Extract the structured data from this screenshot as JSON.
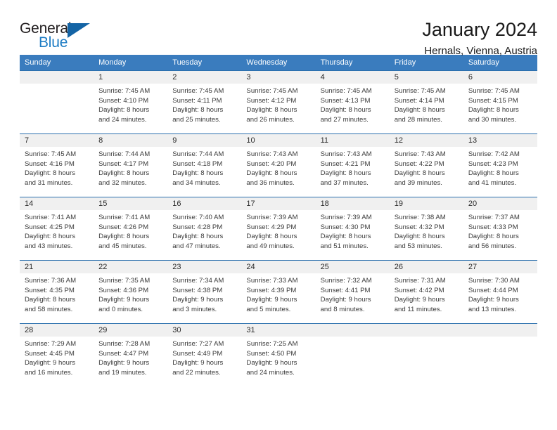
{
  "brand": {
    "name_top": "General",
    "name_bottom": "Blue",
    "accent_color": "#1d7cc4",
    "triangle_color": "#1464a5"
  },
  "header": {
    "title": "January 2024",
    "subtitle": "Hernals, Vienna, Austria"
  },
  "calendar": {
    "header_bg": "#3a7cbe",
    "daynum_bg": "#f0f0f0",
    "row_rule_color": "#2a6fad",
    "weekday_headers": [
      "Sunday",
      "Monday",
      "Tuesday",
      "Wednesday",
      "Thursday",
      "Friday",
      "Saturday"
    ],
    "weeks": [
      [
        {
          "day": "",
          "lines": []
        },
        {
          "day": "1",
          "lines": [
            "Sunrise: 7:45 AM",
            "Sunset: 4:10 PM",
            "Daylight: 8 hours",
            "and 24 minutes."
          ]
        },
        {
          "day": "2",
          "lines": [
            "Sunrise: 7:45 AM",
            "Sunset: 4:11 PM",
            "Daylight: 8 hours",
            "and 25 minutes."
          ]
        },
        {
          "day": "3",
          "lines": [
            "Sunrise: 7:45 AM",
            "Sunset: 4:12 PM",
            "Daylight: 8 hours",
            "and 26 minutes."
          ]
        },
        {
          "day": "4",
          "lines": [
            "Sunrise: 7:45 AM",
            "Sunset: 4:13 PM",
            "Daylight: 8 hours",
            "and 27 minutes."
          ]
        },
        {
          "day": "5",
          "lines": [
            "Sunrise: 7:45 AM",
            "Sunset: 4:14 PM",
            "Daylight: 8 hours",
            "and 28 minutes."
          ]
        },
        {
          "day": "6",
          "lines": [
            "Sunrise: 7:45 AM",
            "Sunset: 4:15 PM",
            "Daylight: 8 hours",
            "and 30 minutes."
          ]
        }
      ],
      [
        {
          "day": "7",
          "lines": [
            "Sunrise: 7:45 AM",
            "Sunset: 4:16 PM",
            "Daylight: 8 hours",
            "and 31 minutes."
          ]
        },
        {
          "day": "8",
          "lines": [
            "Sunrise: 7:44 AM",
            "Sunset: 4:17 PM",
            "Daylight: 8 hours",
            "and 32 minutes."
          ]
        },
        {
          "day": "9",
          "lines": [
            "Sunrise: 7:44 AM",
            "Sunset: 4:18 PM",
            "Daylight: 8 hours",
            "and 34 minutes."
          ]
        },
        {
          "day": "10",
          "lines": [
            "Sunrise: 7:43 AM",
            "Sunset: 4:20 PM",
            "Daylight: 8 hours",
            "and 36 minutes."
          ]
        },
        {
          "day": "11",
          "lines": [
            "Sunrise: 7:43 AM",
            "Sunset: 4:21 PM",
            "Daylight: 8 hours",
            "and 37 minutes."
          ]
        },
        {
          "day": "12",
          "lines": [
            "Sunrise: 7:43 AM",
            "Sunset: 4:22 PM",
            "Daylight: 8 hours",
            "and 39 minutes."
          ]
        },
        {
          "day": "13",
          "lines": [
            "Sunrise: 7:42 AM",
            "Sunset: 4:23 PM",
            "Daylight: 8 hours",
            "and 41 minutes."
          ]
        }
      ],
      [
        {
          "day": "14",
          "lines": [
            "Sunrise: 7:41 AM",
            "Sunset: 4:25 PM",
            "Daylight: 8 hours",
            "and 43 minutes."
          ]
        },
        {
          "day": "15",
          "lines": [
            "Sunrise: 7:41 AM",
            "Sunset: 4:26 PM",
            "Daylight: 8 hours",
            "and 45 minutes."
          ]
        },
        {
          "day": "16",
          "lines": [
            "Sunrise: 7:40 AM",
            "Sunset: 4:28 PM",
            "Daylight: 8 hours",
            "and 47 minutes."
          ]
        },
        {
          "day": "17",
          "lines": [
            "Sunrise: 7:39 AM",
            "Sunset: 4:29 PM",
            "Daylight: 8 hours",
            "and 49 minutes."
          ]
        },
        {
          "day": "18",
          "lines": [
            "Sunrise: 7:39 AM",
            "Sunset: 4:30 PM",
            "Daylight: 8 hours",
            "and 51 minutes."
          ]
        },
        {
          "day": "19",
          "lines": [
            "Sunrise: 7:38 AM",
            "Sunset: 4:32 PM",
            "Daylight: 8 hours",
            "and 53 minutes."
          ]
        },
        {
          "day": "20",
          "lines": [
            "Sunrise: 7:37 AM",
            "Sunset: 4:33 PM",
            "Daylight: 8 hours",
            "and 56 minutes."
          ]
        }
      ],
      [
        {
          "day": "21",
          "lines": [
            "Sunrise: 7:36 AM",
            "Sunset: 4:35 PM",
            "Daylight: 8 hours",
            "and 58 minutes."
          ]
        },
        {
          "day": "22",
          "lines": [
            "Sunrise: 7:35 AM",
            "Sunset: 4:36 PM",
            "Daylight: 9 hours",
            "and 0 minutes."
          ]
        },
        {
          "day": "23",
          "lines": [
            "Sunrise: 7:34 AM",
            "Sunset: 4:38 PM",
            "Daylight: 9 hours",
            "and 3 minutes."
          ]
        },
        {
          "day": "24",
          "lines": [
            "Sunrise: 7:33 AM",
            "Sunset: 4:39 PM",
            "Daylight: 9 hours",
            "and 5 minutes."
          ]
        },
        {
          "day": "25",
          "lines": [
            "Sunrise: 7:32 AM",
            "Sunset: 4:41 PM",
            "Daylight: 9 hours",
            "and 8 minutes."
          ]
        },
        {
          "day": "26",
          "lines": [
            "Sunrise: 7:31 AM",
            "Sunset: 4:42 PM",
            "Daylight: 9 hours",
            "and 11 minutes."
          ]
        },
        {
          "day": "27",
          "lines": [
            "Sunrise: 7:30 AM",
            "Sunset: 4:44 PM",
            "Daylight: 9 hours",
            "and 13 minutes."
          ]
        }
      ],
      [
        {
          "day": "28",
          "lines": [
            "Sunrise: 7:29 AM",
            "Sunset: 4:45 PM",
            "Daylight: 9 hours",
            "and 16 minutes."
          ]
        },
        {
          "day": "29",
          "lines": [
            "Sunrise: 7:28 AM",
            "Sunset: 4:47 PM",
            "Daylight: 9 hours",
            "and 19 minutes."
          ]
        },
        {
          "day": "30",
          "lines": [
            "Sunrise: 7:27 AM",
            "Sunset: 4:49 PM",
            "Daylight: 9 hours",
            "and 22 minutes."
          ]
        },
        {
          "day": "31",
          "lines": [
            "Sunrise: 7:25 AM",
            "Sunset: 4:50 PM",
            "Daylight: 9 hours",
            "and 24 minutes."
          ]
        },
        {
          "day": "",
          "lines": []
        },
        {
          "day": "",
          "lines": []
        },
        {
          "day": "",
          "lines": []
        }
      ]
    ]
  }
}
